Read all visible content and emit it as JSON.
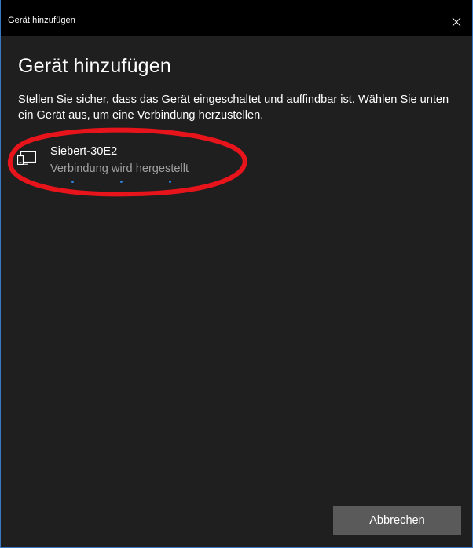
{
  "window": {
    "title": "Gerät hinzufügen",
    "close_icon": "close-icon"
  },
  "main": {
    "heading": "Gerät hinzufügen",
    "description": "Stellen Sie sicher, dass das Gerät eingeschaltet und auffindbar ist. Wählen Sie unten ein Gerät aus, um eine Verbindung herzustellen."
  },
  "device": {
    "icon": "display-device-icon",
    "name": "Siebert-30E2",
    "status": "Verbindung wird hergestellt",
    "status_color": "#a0a0a0"
  },
  "footer": {
    "cancel_label": "Abbrechen"
  },
  "colors": {
    "background": "#1f1f1f",
    "titlebar": "#000000",
    "accent": "#2c7fe0",
    "annotation": "#e8141c",
    "button": "#5a5a5a",
    "window_border": "#3b78c4"
  }
}
